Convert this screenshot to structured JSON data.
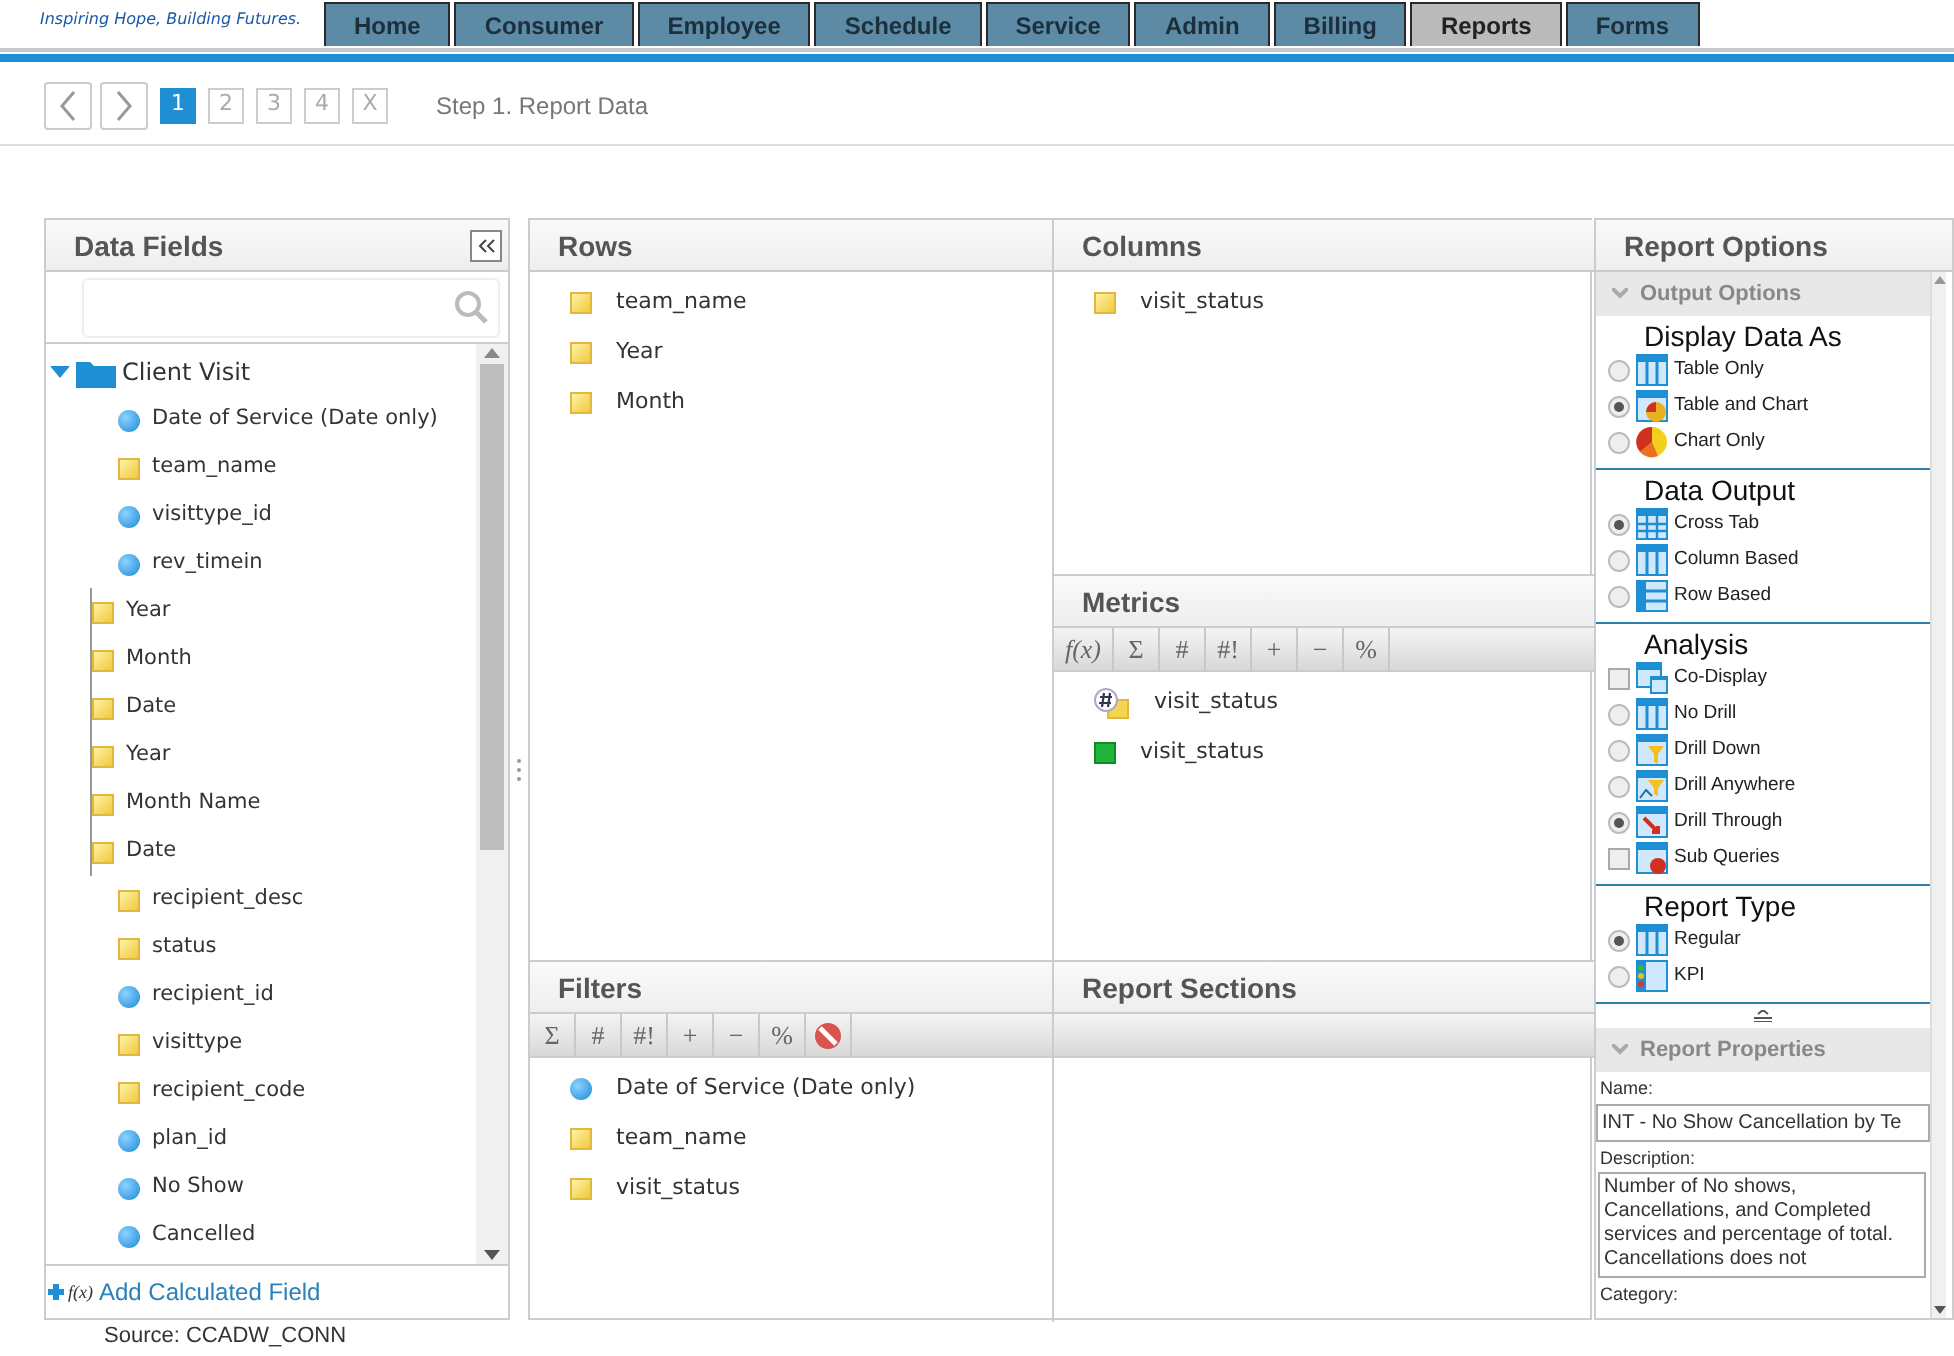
{
  "header": {
    "tagline": "Inspiring Hope, Building Futures.",
    "tabs": [
      {
        "label": "Home",
        "selected": false
      },
      {
        "label": "Consumer",
        "selected": false
      },
      {
        "label": "Employee",
        "selected": false
      },
      {
        "label": "Schedule",
        "selected": false
      },
      {
        "label": "Service",
        "selected": false
      },
      {
        "label": "Admin",
        "selected": false
      },
      {
        "label": "Billing",
        "selected": false
      },
      {
        "label": "Reports",
        "selected": true
      },
      {
        "label": "Forms",
        "selected": false
      }
    ]
  },
  "wizard": {
    "steps": [
      {
        "label": "1",
        "selected": true
      },
      {
        "label": "2",
        "selected": false
      },
      {
        "label": "3",
        "selected": false
      },
      {
        "label": "4",
        "selected": false
      },
      {
        "label": "X",
        "selected": false
      }
    ],
    "caption": "Step 1. Report Data"
  },
  "data_fields": {
    "title": "Data Fields",
    "tree": {
      "label": "Client Visit",
      "expanded": true,
      "children": [
        {
          "label": "Date of Service (Date only)",
          "kind": "measure"
        },
        {
          "label": "team_name",
          "kind": "dimension"
        },
        {
          "label": "visittype_id",
          "kind": "measure"
        },
        {
          "label": "rev_timein",
          "kind": "measure"
        },
        {
          "kind": "hierarchy",
          "children": [
            {
              "label": "Year",
              "kind": "dimension"
            },
            {
              "label": "Month",
              "kind": "dimension"
            },
            {
              "label": "Date",
              "kind": "dimension"
            }
          ]
        },
        {
          "kind": "hierarchy",
          "children": [
            {
              "label": "Year",
              "kind": "dimension"
            },
            {
              "label": "Month Name",
              "kind": "dimension"
            },
            {
              "label": "Date",
              "kind": "dimension"
            }
          ]
        },
        {
          "label": "recipient_desc",
          "kind": "dimension"
        },
        {
          "label": "status",
          "kind": "dimension"
        },
        {
          "label": "recipient_id",
          "kind": "measure"
        },
        {
          "label": "visittype",
          "kind": "dimension"
        },
        {
          "label": "recipient_code",
          "kind": "dimension"
        },
        {
          "label": "plan_id",
          "kind": "measure"
        },
        {
          "label": "No Show",
          "kind": "measure"
        },
        {
          "label": "Cancelled",
          "kind": "measure"
        }
      ]
    },
    "add_link_icon": "f(x)",
    "add_link": "Add Calculated Field",
    "source": "Source: CCADW_CONN"
  },
  "rows": {
    "title": "Rows",
    "items": [
      {
        "label": "team_name",
        "kind": "dimension"
      },
      {
        "label": "Year",
        "kind": "dimension"
      },
      {
        "label": "Month",
        "kind": "dimension"
      }
    ]
  },
  "columns": {
    "title": "Columns",
    "items": [
      {
        "label": "visit_status",
        "kind": "dimension"
      }
    ]
  },
  "metrics": {
    "title": "Metrics",
    "tools": [
      "f(x)",
      "Σ",
      "#",
      "#!",
      "+",
      "−",
      "%"
    ],
    "items": [
      {
        "label": "visit_status",
        "kind": "count"
      },
      {
        "label": "visit_status",
        "kind": "metric"
      }
    ]
  },
  "filters": {
    "title": "Filters",
    "tools": [
      "Σ",
      "#",
      "#!",
      "+",
      "−",
      "%"
    ],
    "items": [
      {
        "label": "Date of Service (Date only)",
        "kind": "measure"
      },
      {
        "label": "team_name",
        "kind": "dimension"
      },
      {
        "label": "visit_status",
        "kind": "dimension"
      }
    ]
  },
  "report_sections": {
    "title": "Report Sections"
  },
  "report_options": {
    "title": "Report Options",
    "output_options": {
      "label": "Output Options",
      "expanded": true
    },
    "groups": [
      {
        "title": "Display Data As",
        "options": [
          {
            "label": "Table Only",
            "kind": "radio",
            "checked": false
          },
          {
            "label": "Table and Chart",
            "kind": "radio",
            "checked": true
          },
          {
            "label": "Chart Only",
            "kind": "radio",
            "checked": false
          }
        ]
      },
      {
        "title": "Data Output",
        "options": [
          {
            "label": "Cross Tab",
            "kind": "radio",
            "checked": true
          },
          {
            "label": "Column Based",
            "kind": "radio",
            "checked": false
          },
          {
            "label": "Row Based",
            "kind": "radio",
            "checked": false
          }
        ]
      },
      {
        "title": "Analysis",
        "options": [
          {
            "label": "Co-Display",
            "kind": "checkbox",
            "checked": false
          },
          {
            "label": "No Drill",
            "kind": "radio",
            "checked": false
          },
          {
            "label": "Drill Down",
            "kind": "radio",
            "checked": false
          },
          {
            "label": "Drill Anywhere",
            "kind": "radio",
            "checked": false
          },
          {
            "label": "Drill Through",
            "kind": "radio",
            "checked": true
          },
          {
            "label": "Sub Queries",
            "kind": "checkbox",
            "checked": false
          }
        ]
      },
      {
        "title": "Report Type",
        "options": [
          {
            "label": "Regular",
            "kind": "radio",
            "checked": true
          },
          {
            "label": "KPI",
            "kind": "radio",
            "checked": false
          }
        ]
      }
    ],
    "report_properties": {
      "label": "Report Properties",
      "expanded": true,
      "name_label": "Name:",
      "name_value": "INT - No Show Cancellation by Te",
      "description_label": "Description:",
      "description": "Number of No shows, Cancellations, and Completed services and percentage of total.  Cancellations does not",
      "category_label": "Category:"
    }
  }
}
